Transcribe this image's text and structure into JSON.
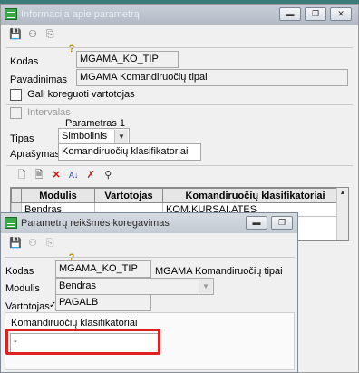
{
  "back_window": {
    "title": "Informacija apie parametrą",
    "controls": {
      "minimize": "▬",
      "restore": "❐",
      "close": "✕"
    },
    "toolbar_icons": [
      "save-icon",
      "users-icon",
      "copy-icon",
      "help-icon"
    ],
    "kodas_label": "Kodas",
    "kodas_value": "MGAMA_KO_TIP",
    "pavadinimas_label": "Pavadinimas",
    "pavadinimas_value": "MGAMA Komandiruočių tipai",
    "gali_koreguoti_label": "Gali koreguoti vartotojas",
    "intervalas_label": "Intervalas",
    "parametras_header": "Parametras 1",
    "tipas_label": "Tipas",
    "tipas_value": "Simbolinis",
    "aprasymas_label": "Aprašymas",
    "aprasymas_value": "Komandiruočių klasifikatoriai",
    "grid": {
      "columns": [
        "Modulis",
        "Vartotojas",
        "Komandiruočių klasifikatoriai"
      ],
      "rows": [
        [
          "Bendras",
          "",
          "KOM,KURSAI,ATES"
        ]
      ]
    }
  },
  "front_window": {
    "title": "Parametrų reikšmės koregavimas",
    "controls": {
      "minimize": "▬",
      "restore": "❐"
    },
    "kodas_label": "Kodas",
    "kodas_value": "MGAMA_KO_TIP",
    "kodas_name": "MGAMA Komandiruočių tipai",
    "modulis_label": "Modulis",
    "modulis_value": "Bendras",
    "vartotojas_label": "Vartotojas",
    "vartotojas_value": "PAGALB",
    "klasifikatoriai_label": "Komandiruočių klasifikatoriai",
    "klasifikatoriai_value": "-"
  },
  "colors": {
    "highlight_box": "#e02020",
    "titlebar_inactive": "#b3bac6"
  }
}
